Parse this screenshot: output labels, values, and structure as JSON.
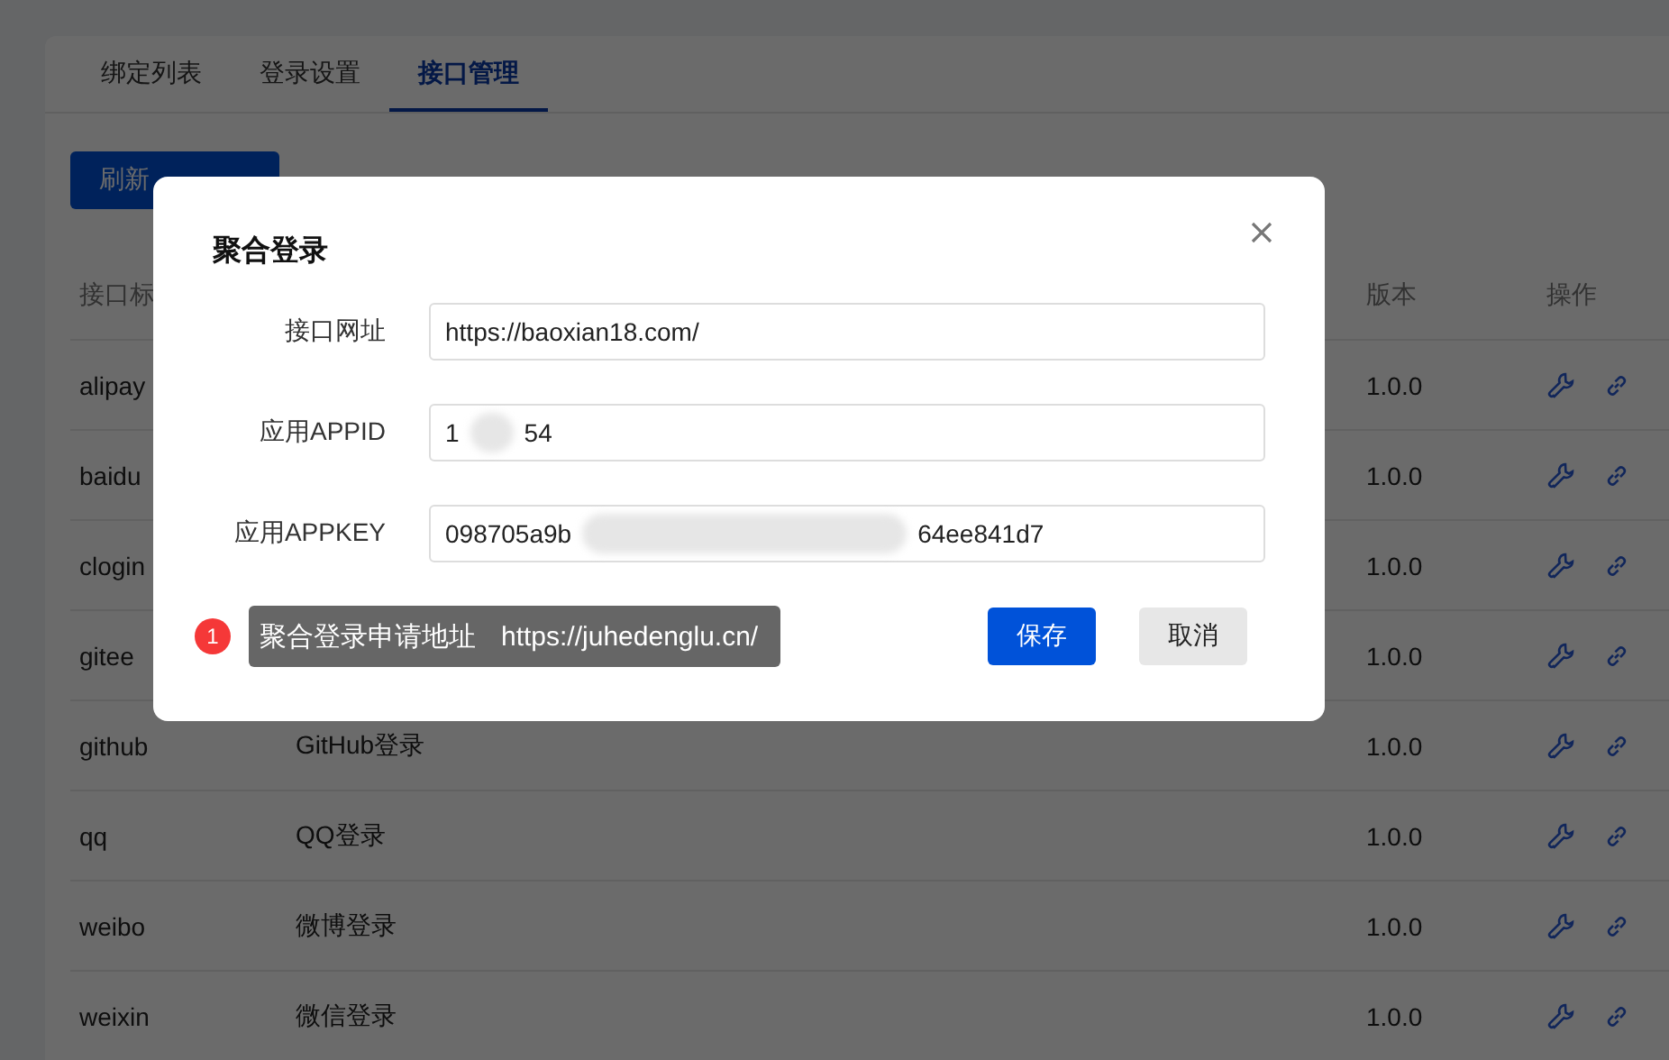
{
  "tabs": [
    {
      "label": "绑定列表",
      "selected": false
    },
    {
      "label": "登录设置",
      "selected": false
    },
    {
      "label": "接口管理",
      "selected": true
    }
  ],
  "refresh_button": "刷新",
  "table": {
    "columns": [
      "接口标",
      "版本",
      "操作"
    ],
    "rows": [
      {
        "name": "alipay",
        "version": "1.0.0"
      },
      {
        "name": "baidu",
        "version": "1.0.0"
      },
      {
        "name": "clogin",
        "version": "1.0.0"
      },
      {
        "name": "gitee",
        "version": "1.0.0"
      },
      {
        "name": "github",
        "description": "GitHub登录",
        "version": "1.0.0"
      },
      {
        "name": "qq",
        "description": "QQ登录",
        "version": "1.0.0"
      },
      {
        "name": "weibo",
        "description": "微博登录",
        "version": "1.0.0"
      },
      {
        "name": "weixin",
        "description": "微信登录",
        "version": "1.0.0"
      }
    ]
  },
  "dialog": {
    "title": "聚合登录",
    "fields": [
      {
        "label": "接口网址",
        "value": "https://baoxian18.com/"
      },
      {
        "label": "应用APPID",
        "value_start": "1",
        "value_end": "54"
      },
      {
        "label": "应用APPKEY",
        "value_start": "098705a9b",
        "value_end": "64ee841d7"
      }
    ],
    "hint": {
      "badge": "1",
      "text": "聚合登录申请地址",
      "link": "https://juhedenglu.cn/"
    },
    "buttons": [
      {
        "label": "保存",
        "kind": "primary"
      },
      {
        "label": "取消",
        "kind": "secondary"
      }
    ]
  }
}
